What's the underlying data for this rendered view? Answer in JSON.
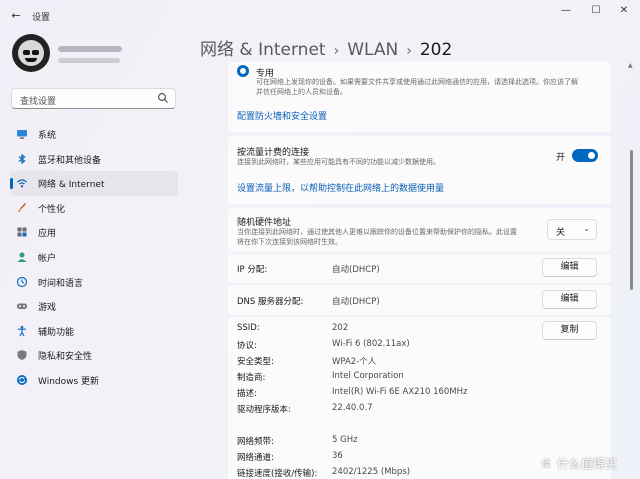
{
  "window": {
    "title": "设置",
    "back_glyph": "←",
    "minimize_glyph": "—",
    "maximize_glyph": "☐",
    "close_glyph": "✕"
  },
  "search": {
    "placeholder": "查找设置"
  },
  "sidebar": {
    "items": [
      {
        "label": "系统",
        "icon": "monitor-icon",
        "active": false
      },
      {
        "label": "蓝牙和其他设备",
        "icon": "bluetooth-icon",
        "active": false
      },
      {
        "label": "网络 & Internet",
        "icon": "wifi-icon",
        "active": true
      },
      {
        "label": "个性化",
        "icon": "brush-icon",
        "active": false
      },
      {
        "label": "应用",
        "icon": "apps-icon",
        "active": false
      },
      {
        "label": "帐户",
        "icon": "person-icon",
        "active": false
      },
      {
        "label": "时间和语言",
        "icon": "globe-clock-icon",
        "active": false
      },
      {
        "label": "游戏",
        "icon": "gamepad-icon",
        "active": false
      },
      {
        "label": "辅助功能",
        "icon": "accessibility-icon",
        "active": false
      },
      {
        "label": "隐私和安全性",
        "icon": "shield-icon",
        "active": false
      },
      {
        "label": "Windows 更新",
        "icon": "sync-icon",
        "active": false
      }
    ]
  },
  "breadcrumb": {
    "part1": "网络 & Internet",
    "part2": "WLAN",
    "current": "202",
    "separator": "›"
  },
  "network_profile": {
    "option_label": "专用",
    "option_desc_1": "可在网络上发现你的设备。如果需要文件共享或使用通过此网络通信的应用，请选择此选项。你应该了解",
    "option_desc_2": "并信任网络上的人员和设备。",
    "firewall_link": "配置防火墙和安全设置"
  },
  "metered": {
    "title": "按流量计费的连接",
    "desc": "连接到此网络时，某些应用可能具有不同的功能以减少数据使用。",
    "toggle_label": "开",
    "toggle_on": true,
    "data_limit_link": "设置流量上限，以帮助控制在此网络上的数据使用量"
  },
  "random_mac": {
    "title": "随机硬件地址",
    "desc_1": "当你连接到此网络时，通过使其他人更难以跟踪你的设备位置来帮助保护你的隐私。此设置",
    "desc_2": "将在你下次连接到该网络时生效。",
    "value": "关",
    "chevron": "⌄"
  },
  "ip": {
    "label": "IP 分配:",
    "value": "自动(DHCP)",
    "button": "编辑"
  },
  "dns": {
    "label": "DNS 服务器分配:",
    "value": "自动(DHCP)",
    "button": "编辑"
  },
  "properties": {
    "copy_button": "复制",
    "rows": [
      {
        "label": "SSID:",
        "value": "202"
      },
      {
        "label": "协议:",
        "value": "Wi-Fi 6 (802.11ax)"
      },
      {
        "label": "安全类型:",
        "value": "WPA2-个人"
      },
      {
        "label": "制造商:",
        "value": "Intel Corporation"
      },
      {
        "label": "描述:",
        "value": "Intel(R) Wi-Fi 6E AX210 160MHz"
      },
      {
        "label": "驱动程序版本:",
        "value": "22.40.0.7"
      },
      {
        "label": "网络频带:",
        "value": "5 GHz"
      },
      {
        "label": "网络通道:",
        "value": "36"
      },
      {
        "label": "链接速度(接收/传输):",
        "value": "2402/1225 (Mbps)"
      }
    ]
  },
  "watermark": {
    "text": "什么值得买"
  },
  "colors": {
    "accent": "#0067c0",
    "link": "#0a5cb8",
    "card": "#fbfbfc"
  }
}
